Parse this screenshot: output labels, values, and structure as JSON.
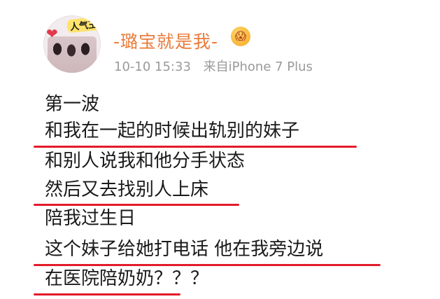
{
  "post": {
    "author": {
      "avatar_label": "人气王",
      "name": "-璐宝就是我-",
      "badge_emoji": "😱"
    },
    "time": "10-10 15:33",
    "source": "来自iPhone 7 Plus",
    "lines": [
      {
        "text": "第一波",
        "highlighted": false
      },
      {
        "text": "和我在一起的时候出轨别的妹子",
        "highlighted": true
      },
      {
        "text": "和别人说我和他分手状态",
        "highlighted": false
      },
      {
        "text": "然后又去找别人上床",
        "highlighted": true
      },
      {
        "text": "陪我过生日",
        "highlighted": false
      },
      {
        "text": "这个妹子给她打电话 他在我旁边说",
        "highlighted": true
      },
      {
        "text": "在医院陪奶奶？？？",
        "highlighted": false
      }
    ],
    "underline_color": "#e31b2a",
    "name_color": "#e97b3a"
  }
}
